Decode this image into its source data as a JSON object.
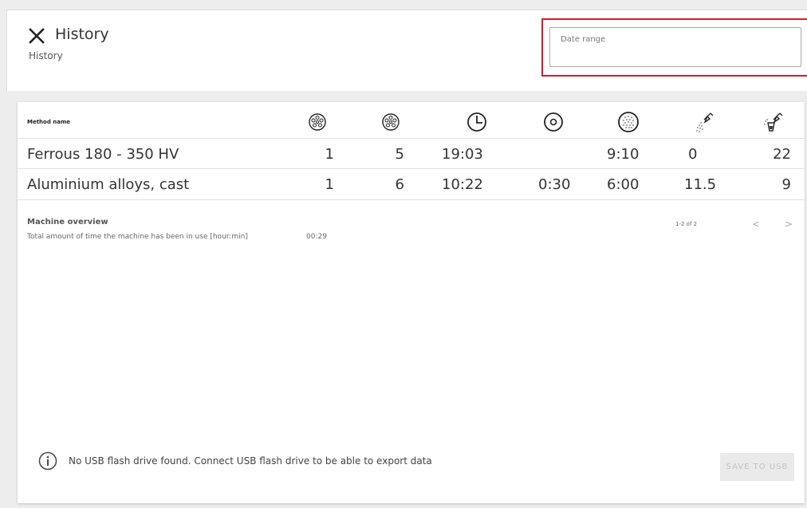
{
  "header": {
    "title": "History",
    "subtitle": "History",
    "close_icon": "close-icon",
    "date_range_label": "Date range"
  },
  "table": {
    "method_header": "Method name",
    "column_icons": [
      "sample-holder-icon",
      "sample-holder-icon",
      "clock-icon",
      "disc-icon",
      "dotted-disc-icon",
      "spray-nozzle-icon",
      "spray-bottle-icon"
    ],
    "rows": [
      {
        "name": "Ferrous 180 - 350 HV",
        "values": [
          "1",
          "5",
          "19:03",
          "",
          "9:10",
          "0",
          "22"
        ]
      },
      {
        "name": "Aluminium alloys, cast",
        "values": [
          "1",
          "6",
          "10:22",
          "0:30",
          "6:00",
          "11.5",
          "9"
        ]
      }
    ]
  },
  "overview": {
    "title": "Machine overview",
    "description": "Total amount of time the machine has been in use [hour:min]",
    "value": "00:29"
  },
  "pagination": {
    "range": "1-2 of 2",
    "prev_label": "<",
    "next_label": ">"
  },
  "footer": {
    "usb_message": "No USB flash drive found. Connect USB flash drive to be able to export data",
    "save_label": "SAVE TO USB",
    "info_icon": "info-icon"
  },
  "colors": {
    "highlight_border": "#c8232c",
    "text_primary": "#333333",
    "disabled_text": "#c2c2c2"
  }
}
